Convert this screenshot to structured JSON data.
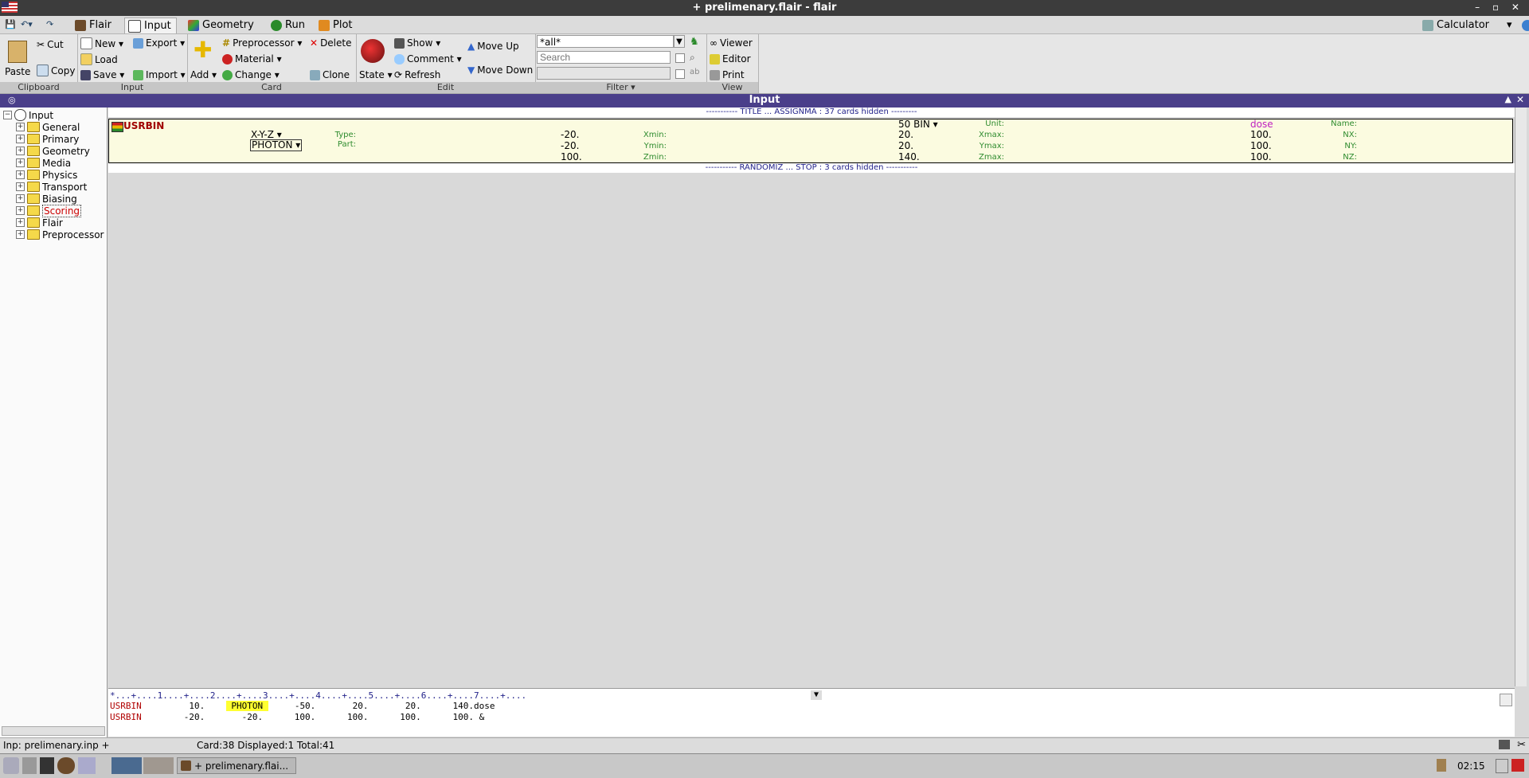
{
  "window": {
    "title": "+ prelimenary.flair - flair",
    "controls": "– ▫ ✕"
  },
  "tabs": [
    {
      "label": "Flair"
    },
    {
      "label": "Input"
    },
    {
      "label": "Geometry"
    },
    {
      "label": "Run"
    },
    {
      "label": "Plot"
    }
  ],
  "calculator": "Calculator",
  "ribbon": {
    "clipboard": {
      "label": "Clipboard",
      "paste": "Paste",
      "cut": "Cut",
      "copy": "Copy"
    },
    "input": {
      "label": "Input",
      "new": "New ▾",
      "load": "Load",
      "save": "Save ▾",
      "export": "Export ▾",
      "import": "Import ▾"
    },
    "card": {
      "label": "Card",
      "add": "Add ▾",
      "preprocessor": "Preprocessor ▾",
      "material": "Material ▾",
      "change": "Change ▾",
      "delete": "Delete",
      "clone": "Clone"
    },
    "edit": {
      "label": "Edit",
      "state": "State ▾",
      "show": "Show ▾",
      "comment": "Comment ▾",
      "refresh": "Refresh",
      "move_up": "Move Up",
      "move_down": "Move Down"
    },
    "filter": {
      "label": "Filter ▾",
      "value": "*all*",
      "search_placeholder": "Search"
    },
    "view": {
      "label": "View",
      "viewer": "Viewer",
      "editor": "Editor",
      "print": "Print"
    }
  },
  "panel_title": "Input",
  "tree": {
    "root": "Input",
    "items": [
      "General",
      "Primary",
      "Geometry",
      "Media",
      "Physics",
      "Transport",
      "Biasing",
      "Scoring",
      "Flair",
      "Preprocessor"
    ],
    "selected": "Scoring"
  },
  "cards": {
    "hidden_top": "----------- TITLE ... ASSIGNMA : 37 cards hidden ---------",
    "hidden_bottom": "----------- RANDOMIZ ... STOP : 3 cards hidden -----------",
    "usrbin": {
      "name": "USRBIN",
      "type_label": "Type:",
      "type": "X-Y-Z ▾",
      "part_label": "Part:",
      "part": "PHOTON ▾",
      "xmin_label": "Xmin:",
      "xmin": "-20.",
      "ymin_label": "Ymin:",
      "ymin": "-20.",
      "zmin_label": "Zmin:",
      "zmin": "100.",
      "unit_label": "Unit:",
      "unit": "50 BIN ▾",
      "xmax_label": "Xmax:",
      "xmax": "20.",
      "ymax_label": "Ymax:",
      "ymax": "20.",
      "zmax_label": "Zmax:",
      "zmax": "140.",
      "name_label": "Name:",
      "name_val": "dose",
      "nx_label": "NX:",
      "nx": "100.",
      "ny_label": "NY:",
      "ny": "100.",
      "nz_label": "NZ:",
      "nz": "100."
    }
  },
  "output": {
    "ruler": "*...+....1....+....2....+....3....+....4....+....5....+....6....+....7....+....",
    "row1": {
      "kw": "USRBIN",
      "a": "         10.    ",
      "hl": " PHOTON ",
      "b": "     -50.       20.       20.      140.dose"
    },
    "row2": {
      "kw": "USRBIN",
      "a": "        -20.       -20.      100.      100.      100.      100. &"
    }
  },
  "status": {
    "file": "Inp: prelimenary.inp +",
    "info": "Card:38  Displayed:1  Total:41"
  },
  "taskbar": {
    "window": "+ prelimenary.flai...",
    "clock": "02:15"
  },
  "colors": {
    "panel_header": "#4a3f8a",
    "card_bg": "#fbfbe0",
    "label_green": "#2e8b2e",
    "keyword_red": "#b00000"
  }
}
